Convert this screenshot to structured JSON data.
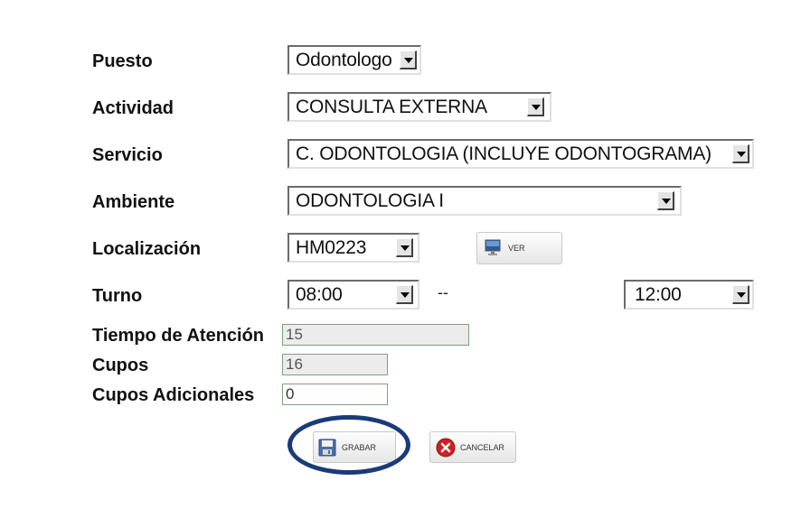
{
  "form": {
    "puesto": {
      "label": "Puesto",
      "value": "Odontologo"
    },
    "actividad": {
      "label": "Actividad",
      "value": "CONSULTA EXTERNA"
    },
    "servicio": {
      "label": "Servicio",
      "value": "C. ODONTOLOGIA (INCLUYE ODONTOGRAMA)"
    },
    "ambiente": {
      "label": "Ambiente",
      "value": "ODONTOLOGIA I"
    },
    "localizacion": {
      "label": "Localización",
      "value": "HM0223",
      "ver_button": "VER"
    },
    "turno": {
      "label": "Turno",
      "start": "08:00",
      "separator": "--",
      "end": "12:00"
    },
    "tiempo": {
      "label": "Tiempo de Atención",
      "value": "15"
    },
    "cupos": {
      "label": "Cupos",
      "value": "16"
    },
    "cupos_adicionales": {
      "label": "Cupos Adicionales",
      "value": "0"
    }
  },
  "actions": {
    "save_label": "GRABAR",
    "cancel_label": "CANCELAR"
  },
  "icons": {
    "ver": "monitor-icon",
    "save": "floppy-disk-icon",
    "cancel": "cancel-x-icon"
  },
  "colors": {
    "highlight": "#1a3a7a",
    "textbox_border": "#7fa07f",
    "cancel_red": "#d02020"
  }
}
